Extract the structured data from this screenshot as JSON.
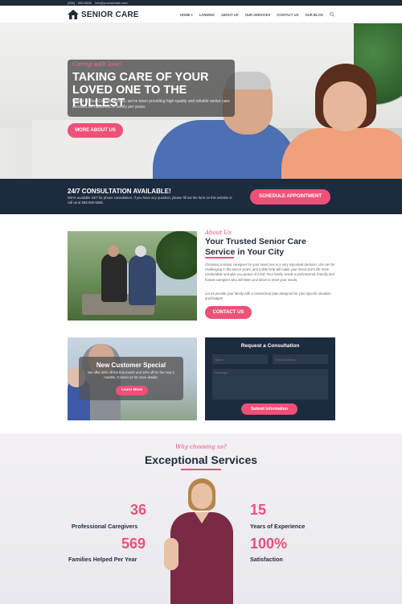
{
  "topbar": {
    "phone": "(555) · 555-5555",
    "email": "info@yourwebsite.com"
  },
  "header": {
    "logo_text": "SENIOR CARE",
    "nav": [
      "HOME",
      "LANDING",
      "ABOUT US",
      "OUR SERVICES",
      "CONTACT US",
      "OUR BLOG"
    ],
    "nav_dropdown_marker": "▾"
  },
  "hero": {
    "tagline": "Caring with love!",
    "title": "TAKING CARE OF YOUR LOVED ONE TO THE FULLEST",
    "description": "Based in Your City since 20xx, we've been providing high-quality and reliable senior care services for hundreds of family per years.",
    "button": "MORE ABOUT US"
  },
  "consultation": {
    "title": "24/7 CONSULTATION AVAILABLE!",
    "text": "We're available 24/7 for phone consultation. If you have any question, please fill out the form on this website or call us at 555-555-5555.",
    "button": "SCHEDULE APPOINTMENT"
  },
  "about": {
    "tagline": "About Us",
    "title": "Your Trusted Senior Care Service in Your City",
    "paragraph1": "Choosing a senior caregiver for your loved one is a very important decision. Life can be challenging in the senior years, and a little help will make your loved one's life more comfortable and give you peace of mind. Your family needs a professional, friendly and honest caregiver who will listen and strive to meet your needs.",
    "paragraph2": "Let us provide your family with a customized plan designed for your specific situation and budget!",
    "button": "CONTACT US"
  },
  "promo": {
    "title": "New Customer Special",
    "text": "We offer 20% off the first month and 10% off for the next 3 months. Contact us for more details.",
    "button": "Learn More"
  },
  "form": {
    "title": "Request a Consultation",
    "name_placeholder": "Name",
    "email_placeholder": "Email Address",
    "message_placeholder": "Message",
    "button": "Submit Information"
  },
  "services": {
    "tagline": "Why choosing us?",
    "title": "Exceptional Services",
    "stats": [
      {
        "number": "36",
        "label": "Professional Caregivers"
      },
      {
        "number": "569",
        "label": "Families Helped Per Year"
      },
      {
        "number": "15",
        "label": "Years of Experience"
      },
      {
        "number": "100%",
        "label": "Satisfaction"
      }
    ]
  },
  "colors": {
    "accent": "#ef5078",
    "navy": "#1d2b3f"
  },
  "icons": [
    "phone-icon",
    "email-icon",
    "house-logo-icon",
    "search-icon"
  ]
}
